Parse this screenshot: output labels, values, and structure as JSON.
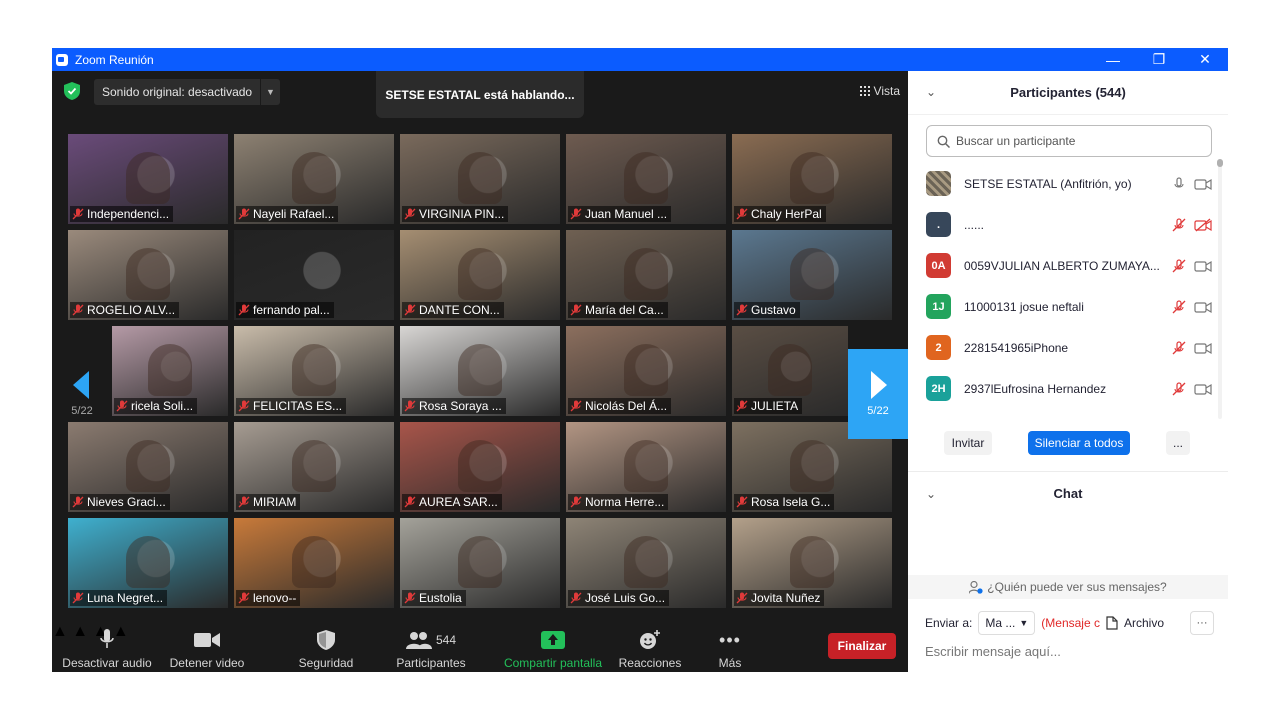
{
  "window": {
    "title": "Zoom Reunión",
    "minimize": "—",
    "restore": "❐",
    "close": "✕"
  },
  "topbar": {
    "sound_label": "Sonido original: desactivado",
    "speaking": "SETSE ESTATAL está hablando...",
    "view_label": "Vista"
  },
  "gallery": {
    "page_left": "5/22",
    "page_right": "5/22",
    "tiles": [
      {
        "name": "Independenci...",
        "bg": "#6a4b7a"
      },
      {
        "name": "Nayeli Rafael...",
        "bg": "#8d8172"
      },
      {
        "name": "VIRGINIA PIN...",
        "bg": "#7a6a5c"
      },
      {
        "name": "Juan Manuel ...",
        "bg": "#6e5b50"
      },
      {
        "name": "Chaly HerPal",
        "bg": "#8a6c52"
      },
      {
        "name": "ROGELIO ALV...",
        "bg": "#9a8a7c"
      },
      {
        "name": "fernando pal...",
        "bg": "#222222"
      },
      {
        "name": "DANTE CON...",
        "bg": "#a58e72"
      },
      {
        "name": "María del Ca...",
        "bg": "#6f6052"
      },
      {
        "name": "Gustavo",
        "bg": "#5b7890"
      },
      {
        "name": "ricela Soli...",
        "bg": "#b59aa6"
      },
      {
        "name": "FELICITAS ES...",
        "bg": "#c9bcaa"
      },
      {
        "name": "Rosa Soraya ...",
        "bg": "#d8d6d4"
      },
      {
        "name": "Nicolás Del Á...",
        "bg": "#8c6f5e"
      },
      {
        "name": "JULIETA",
        "bg": "#5a4e44"
      },
      {
        "name": "Nieves Graci...",
        "bg": "#8b7b70"
      },
      {
        "name": "MIRIAM",
        "bg": "#a69c92"
      },
      {
        "name": "AUREA SAR...",
        "bg": "#a8554a"
      },
      {
        "name": "Norma Herre...",
        "bg": "#b29583"
      },
      {
        "name": "Rosa Isela G...",
        "bg": "#7d7060"
      },
      {
        "name": "Luna Negret...",
        "bg": "#3fb0cf"
      },
      {
        "name": "lenovo--",
        "bg": "#c87a3a"
      },
      {
        "name": "Eustolia",
        "bg": "#a4a29a"
      },
      {
        "name": "José Luis Go...",
        "bg": "#8e8476"
      },
      {
        "name": "Jovita Nuñez",
        "bg": "#b3a08a"
      }
    ]
  },
  "toolbar": {
    "mute": "Desactivar audio",
    "video": "Detener video",
    "security": "Seguridad",
    "participants": "Participantes",
    "participants_count": "544",
    "share": "Compartir pantalla",
    "reactions": "Reacciones",
    "more": "Más",
    "end": "Finalizar"
  },
  "participants": {
    "title": "Participantes (544)",
    "search_placeholder": "Buscar un participante",
    "rows": [
      {
        "initials": "",
        "name": "SETSE ESTATAL (Anfitrión, yo)",
        "color": "#6b6356",
        "muted": false
      },
      {
        "initials": ".",
        "name": "......",
        "color": "#37475a",
        "muted": true
      },
      {
        "initials": "0A",
        "name": "0059VJULIAN ALBERTO ZUMAYA...",
        "color": "#d13b33",
        "muted": true
      },
      {
        "initials": "1J",
        "name": "11000131 josue neftali",
        "color": "#23a45d",
        "muted": true
      },
      {
        "initials": "2",
        "name": "2281541965iPhone",
        "color": "#e0651f",
        "muted": true
      },
      {
        "initials": "2H",
        "name": "2937lEufrosina Hernandez",
        "color": "#1aa19a",
        "muted": true
      }
    ],
    "invite": "Invitar",
    "mute_all": "Silenciar a todos",
    "more": "..."
  },
  "chat": {
    "title": "Chat",
    "who_can_see": "¿Quién puede ver sus mensajes?",
    "send_to_label": "Enviar a:",
    "recipient": "Ma ...",
    "private_note": "(Mensaje c",
    "file": "Archivo",
    "more": "···",
    "placeholder": "Escribir mensaje aquí..."
  }
}
